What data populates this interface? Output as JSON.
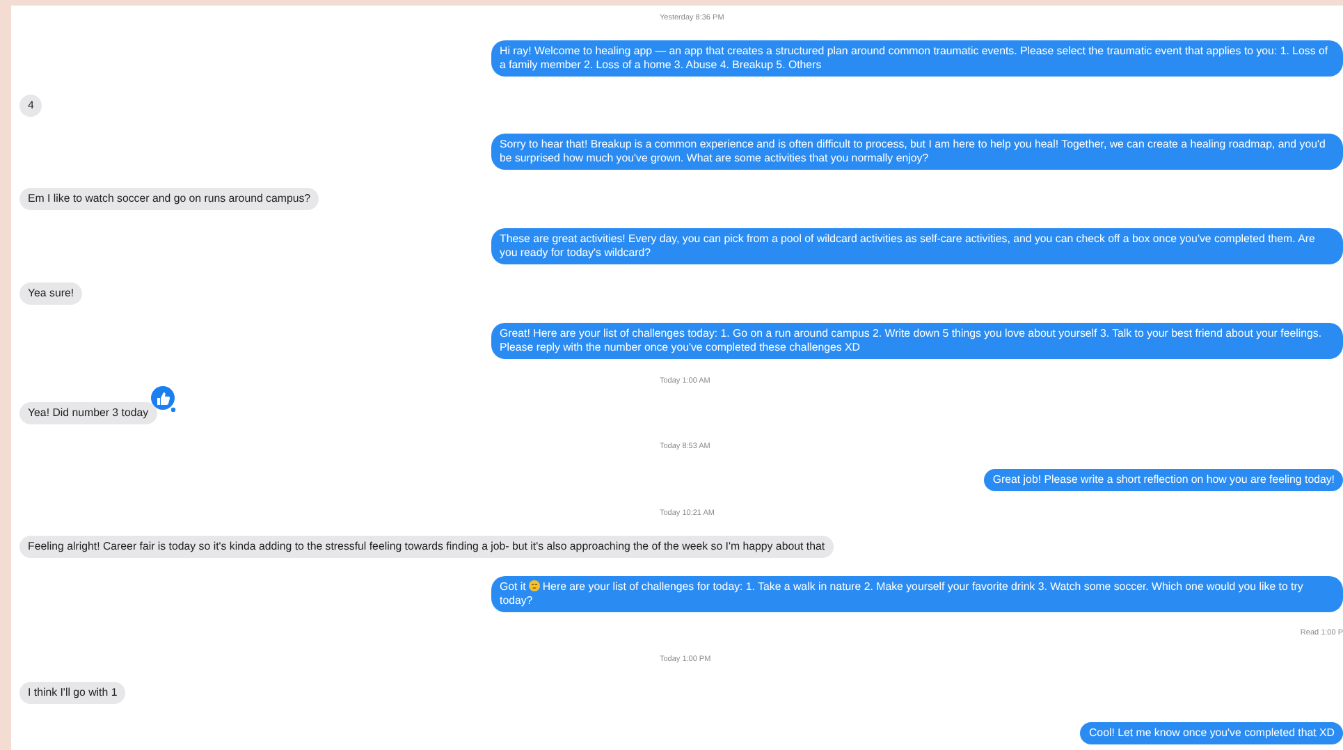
{
  "messages": [
    {
      "kind": "timestamp",
      "text": "Yesterday 8:36 PM"
    },
    {
      "kind": "sent",
      "text": "Hi ray! Welcome to healing app — an app that creates a structured plan around common traumatic events. Please select the traumatic event that applies to you: 1. Loss of a family member 2. Loss of a home 3. Abuse 4. Breakup 5. Others"
    },
    {
      "kind": "received",
      "text": "4"
    },
    {
      "kind": "sent",
      "text": "Sorry to hear that! Breakup is a common experience and is often difficult to process, but I am here to help you heal! Together, we can create a healing roadmap, and you'd be surprised how much you've grown. What are some activities that you normally enjoy?"
    },
    {
      "kind": "received",
      "text": "Em I like to watch soccer and go on runs around campus?"
    },
    {
      "kind": "sent",
      "text": "These are great activities! Every day, you can pick from a pool of wildcard activities as self-care activities, and you can check off a box once you've completed them. Are you ready for today's wildcard?"
    },
    {
      "kind": "received",
      "text": "Yea sure!"
    },
    {
      "kind": "sent",
      "text": "Great! Here are your list of challenges today: 1. Go on a run around campus 2. Write down 5 things you love about yourself 3. Talk to your best friend about your feelings. Please reply with the number once you've completed these challenges XD"
    },
    {
      "kind": "timestamp",
      "text": "Today 1:00 AM"
    },
    {
      "kind": "received",
      "text": "Yea! Did number 3 today",
      "liked": true
    },
    {
      "kind": "timestamp",
      "text": "Today 8:53 AM"
    },
    {
      "kind": "sent",
      "text": "Great job! Please write a short reflection on how you are feeling today!"
    },
    {
      "kind": "timestamp",
      "text": "Today 10:21 AM"
    },
    {
      "kind": "received",
      "text": "Feeling alright! Career fair is today so it's kinda adding to the stressful feeling towards finding a job- but it's also approaching the of the week so I'm happy about that"
    },
    {
      "kind": "sent",
      "text": "Got it",
      "emoji": true,
      "text_after": "Here are your list of challenges for today: 1. Take a walk in nature 2. Make yourself your favorite drink 3. Watch some soccer. Which one would you like to try today?"
    },
    {
      "kind": "receipt",
      "text": "Read 1:00 P"
    },
    {
      "kind": "timestamp",
      "text": "Today 1:00 PM"
    },
    {
      "kind": "received",
      "text": "I think I'll go with 1"
    },
    {
      "kind": "sent",
      "text": "Cool! Let me know once you've completed that XD"
    }
  ]
}
